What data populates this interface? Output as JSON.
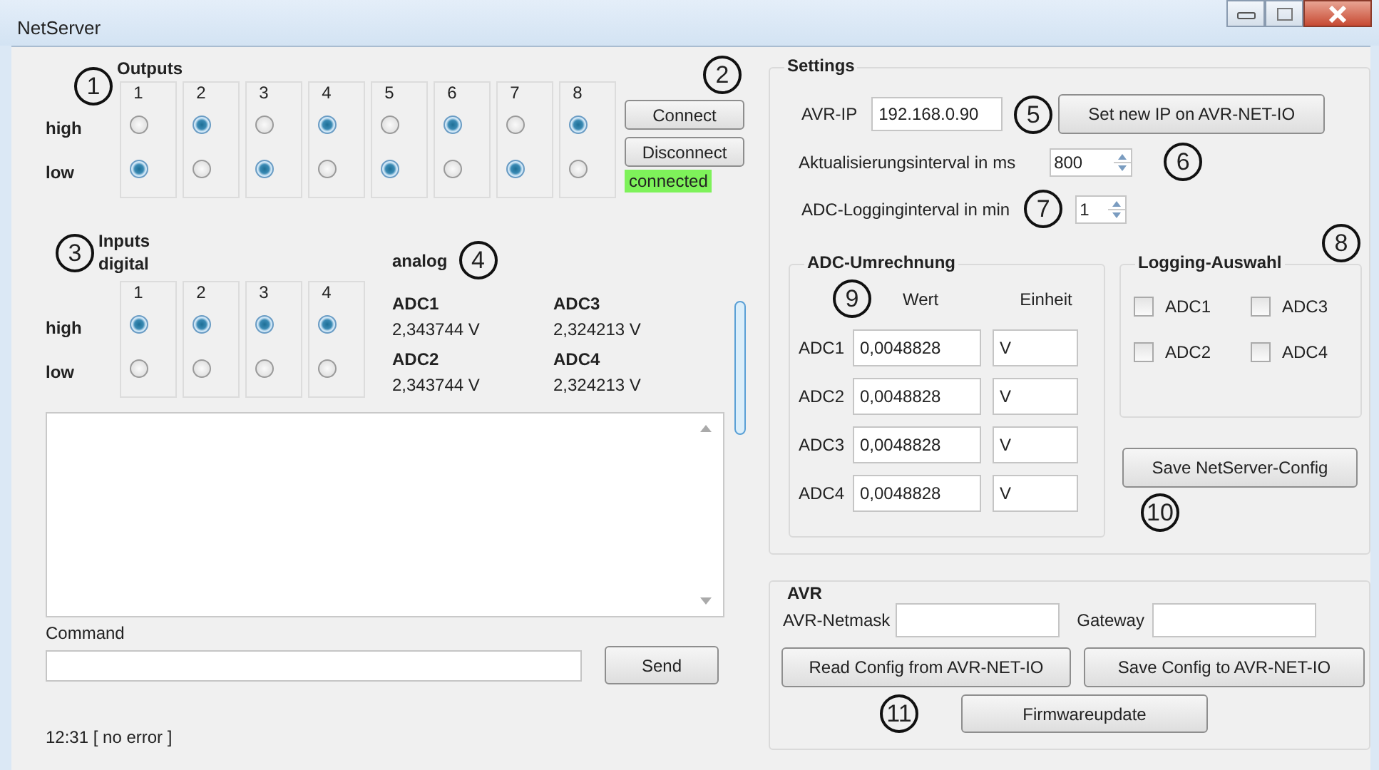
{
  "window": {
    "title": "NetServer"
  },
  "outputs": {
    "title": "Outputs",
    "marker": "1",
    "row_labels": [
      "high",
      "low"
    ],
    "channels": [
      {
        "label": "1",
        "high_selected": false,
        "low_selected": true
      },
      {
        "label": "2",
        "high_selected": true,
        "low_selected": false
      },
      {
        "label": "3",
        "high_selected": false,
        "low_selected": true
      },
      {
        "label": "4",
        "high_selected": true,
        "low_selected": false
      },
      {
        "label": "5",
        "high_selected": false,
        "low_selected": true
      },
      {
        "label": "6",
        "high_selected": true,
        "low_selected": false
      },
      {
        "label": "7",
        "high_selected": false,
        "low_selected": true
      },
      {
        "label": "8",
        "high_selected": true,
        "low_selected": false
      }
    ]
  },
  "connection": {
    "marker": "2",
    "connect_button": "Connect",
    "disconnect_button": "Disconnect",
    "status": "connected"
  },
  "inputs": {
    "title": "Inputs",
    "marker": "3",
    "digital_label": "digital",
    "row_labels": [
      "high",
      "low"
    ],
    "channels": [
      {
        "label": "1",
        "high_selected": true,
        "low_selected": false
      },
      {
        "label": "2",
        "high_selected": true,
        "low_selected": false
      },
      {
        "label": "3",
        "high_selected": true,
        "low_selected": false
      },
      {
        "label": "4",
        "high_selected": true,
        "low_selected": false
      }
    ]
  },
  "analog": {
    "title": "analog",
    "marker": "4",
    "channels": [
      {
        "name": "ADC1",
        "reading": "2,343744 V"
      },
      {
        "name": "ADC3",
        "reading": "2,324213 V"
      },
      {
        "name": "ADC2",
        "reading": "2,343744 V"
      },
      {
        "name": "ADC4",
        "reading": "2,324213 V"
      }
    ]
  },
  "command": {
    "label": "Command",
    "button": "Send"
  },
  "status_bar": "12:31 [ no error ]",
  "settings": {
    "title": "Settings",
    "avr_ip": {
      "label": "AVR-IP",
      "value": "192.168.0.90",
      "marker": "5",
      "button": "Set new IP on AVR-NET-IO"
    },
    "update_interval": {
      "label": "Aktualisierungsinterval in ms",
      "value": "800",
      "marker": "6"
    },
    "logging_interval": {
      "label": "ADC-Logginginterval in min",
      "value": "1",
      "marker": "7"
    },
    "logging_marker": "8",
    "conversion": {
      "title": "ADC-Umrechnung",
      "marker": "9",
      "columns": [
        "Wert",
        "Einheit"
      ],
      "rows": [
        {
          "name": "ADC1",
          "value": "0,0048828",
          "unit": "V"
        },
        {
          "name": "ADC2",
          "value": "0,0048828",
          "unit": "V"
        },
        {
          "name": "ADC3",
          "value": "0,0048828",
          "unit": "V"
        },
        {
          "name": "ADC4",
          "value": "0,0048828",
          "unit": "V"
        }
      ]
    },
    "logging_selection": {
      "title": "Logging-Auswahl",
      "items": [
        {
          "label": "ADC1",
          "checked": false
        },
        {
          "label": "ADC3",
          "checked": false
        },
        {
          "label": "ADC2",
          "checked": false
        },
        {
          "label": "ADC4",
          "checked": false
        }
      ]
    },
    "save_button": "Save NetServer-Config",
    "save_marker": "10"
  },
  "avr": {
    "title": "AVR",
    "netmask_label": "AVR-Netmask",
    "gateway_label": "Gateway",
    "read_button": "Read Config from AVR-NET-IO",
    "save_button": "Save Config to AVR-NET-IO",
    "marker": "11",
    "firmware_button": "Firmwareupdate"
  }
}
